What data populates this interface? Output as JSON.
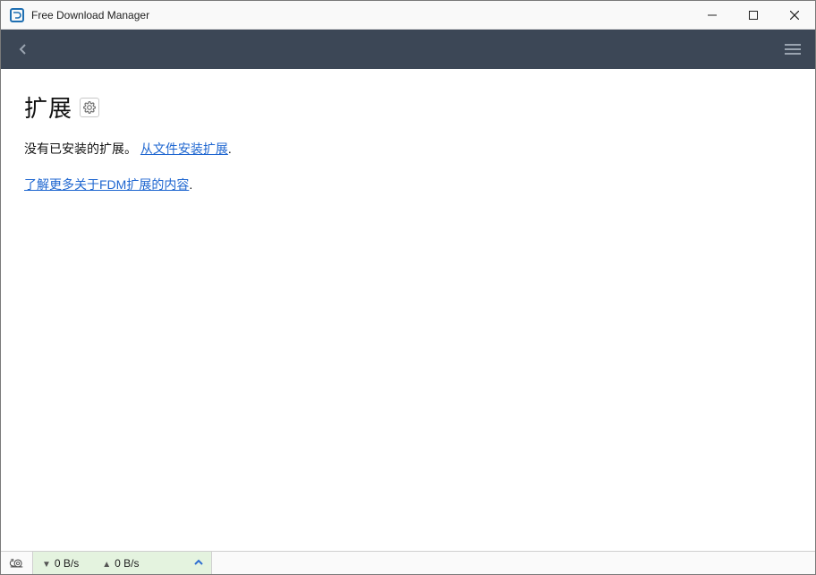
{
  "titlebar": {
    "title": "Free Download Manager"
  },
  "content": {
    "heading": "扩展",
    "no_ext_text": "没有已安装的扩展。 ",
    "install_link": "从文件安装扩展",
    "learn_more_link": "了解更多关于FDM扩展的内容",
    "period": "."
  },
  "statusbar": {
    "download_speed": "0 B/s",
    "upload_speed": "0 B/s"
  }
}
